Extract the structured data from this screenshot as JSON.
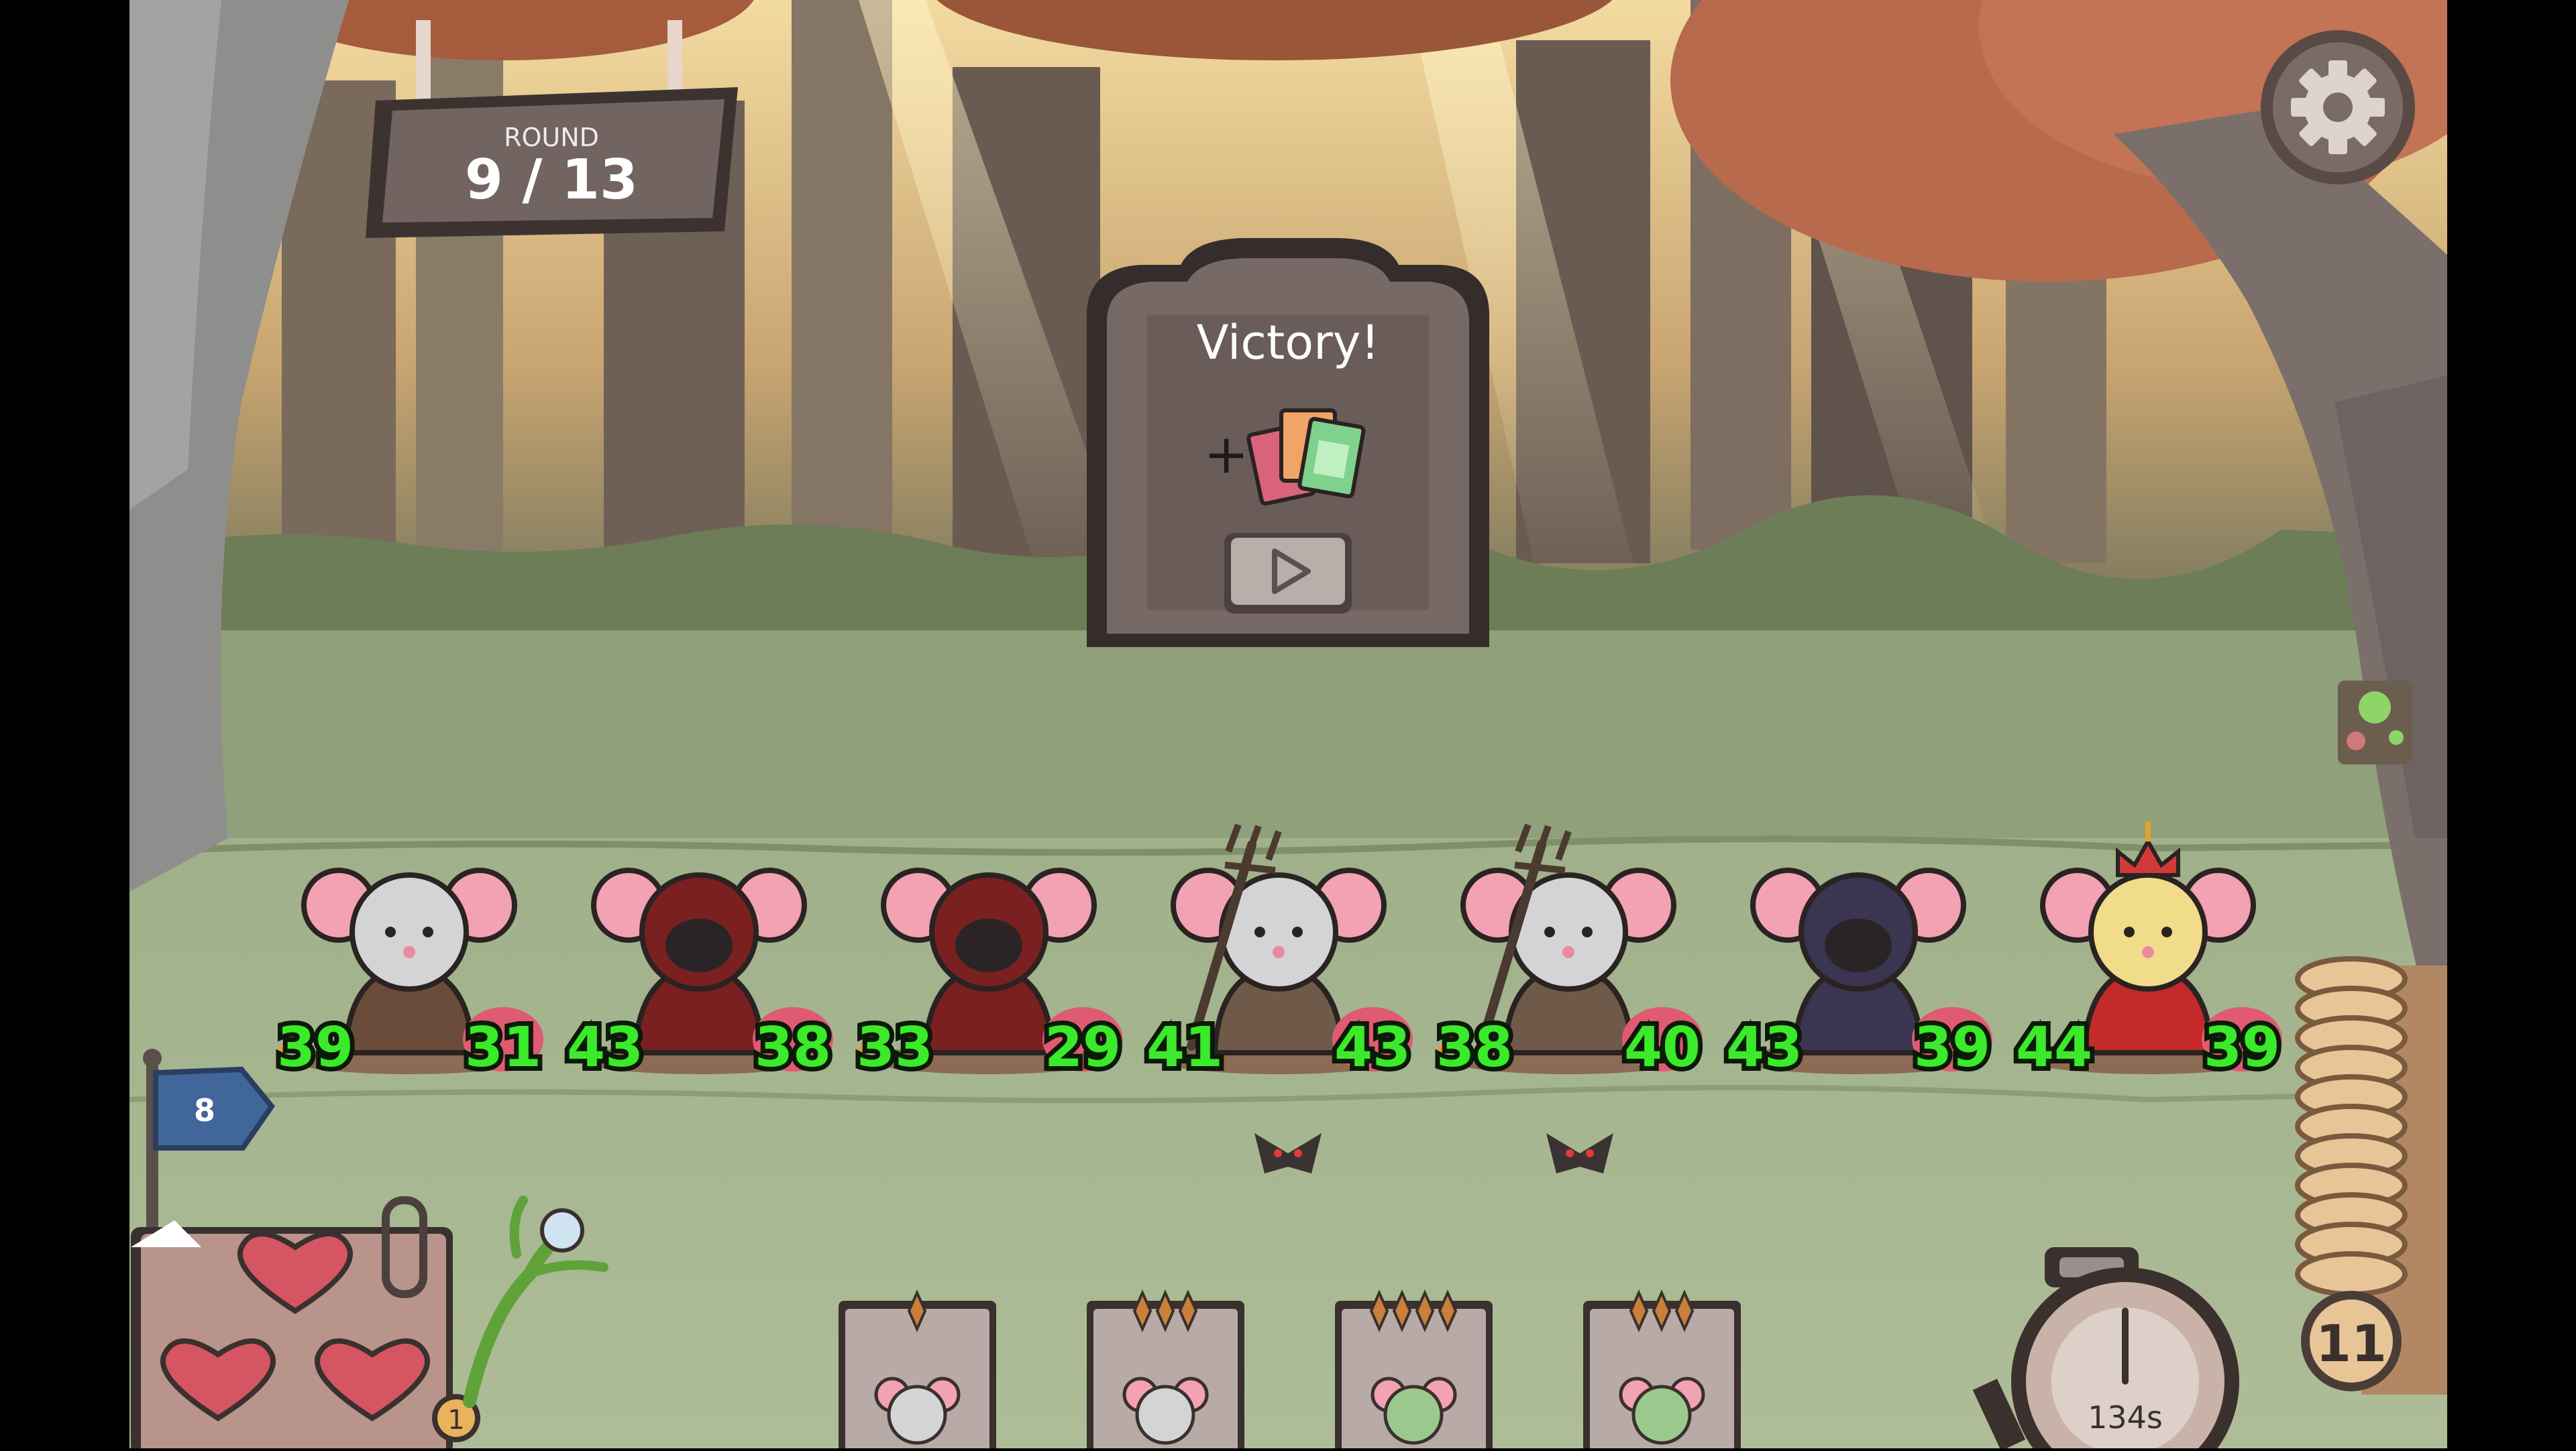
{
  "round": {
    "label": "ROUND",
    "value": "9 / 13"
  },
  "victory": {
    "title": "Victory!",
    "reward_prefix": "+",
    "reward_icon": "cards-icon",
    "continue_icon": "play-icon"
  },
  "settings": {
    "icon": "gear-icon"
  },
  "units": [
    {
      "name": "elder-mouse",
      "attack": "39",
      "health": "31"
    },
    {
      "name": "hooded-mouse",
      "attack": "43",
      "health": "38"
    },
    {
      "name": "hooded-mouse",
      "attack": "33",
      "health": "29"
    },
    {
      "name": "pitchfork-mouse",
      "attack": "41",
      "health": "43"
    },
    {
      "name": "pitchfork-mouse",
      "attack": "38",
      "health": "40"
    },
    {
      "name": "ninja-mouse",
      "attack": "43",
      "health": "39"
    },
    {
      "name": "queen-mouse",
      "attack": "44",
      "health": "39"
    }
  ],
  "flag": {
    "value": "8"
  },
  "lives": {
    "count": 3,
    "icon": "heart-icon"
  },
  "lives_badge": "1",
  "shop_slots": [
    {
      "stars": 1,
      "icon": "mouse-icon"
    },
    {
      "stars": 3,
      "icon": "mouse-icon"
    },
    {
      "stars": 4,
      "icon": "zombie-mouse-icon"
    },
    {
      "stars": 3,
      "icon": "zombie-mouse-icon"
    }
  ],
  "timer": {
    "value": "134s"
  },
  "coins": {
    "value": "11"
  },
  "colors": {
    "stat_green": "#3bea2a",
    "panel": "#6d615d",
    "sky": "#e8c98a"
  }
}
